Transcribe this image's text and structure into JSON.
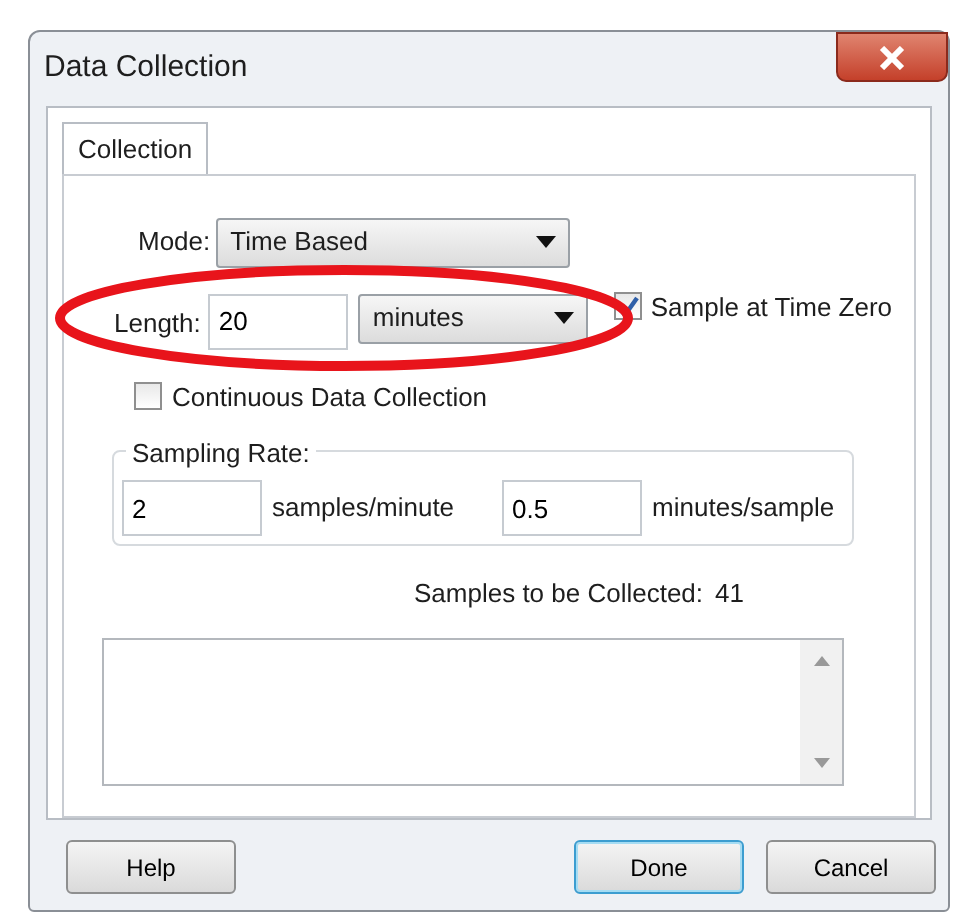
{
  "window": {
    "title": "Data Collection"
  },
  "tabs": [
    {
      "label": "Collection",
      "selected": true
    }
  ],
  "mode": {
    "label": "Mode:",
    "value": "Time Based"
  },
  "length": {
    "label": "Length:",
    "value": "20",
    "unit": "minutes"
  },
  "sample_at_time_zero": {
    "label": "Sample at Time Zero",
    "checked": true
  },
  "continuous": {
    "label": "Continuous Data Collection",
    "checked": false
  },
  "sampling_rate": {
    "legend": "Sampling Rate:",
    "fields": [
      {
        "value": "2",
        "unit": "samples/minute"
      },
      {
        "value": "0.5",
        "unit": "minutes/sample"
      }
    ]
  },
  "samples_to_collect": {
    "label": "Samples to be Collected:",
    "value": "41"
  },
  "buttons": [
    {
      "label": "Help",
      "default": false
    },
    {
      "label": "Done",
      "default": true
    },
    {
      "label": "Cancel",
      "default": false
    }
  ],
  "annotation": {
    "kind": "ellipse"
  }
}
